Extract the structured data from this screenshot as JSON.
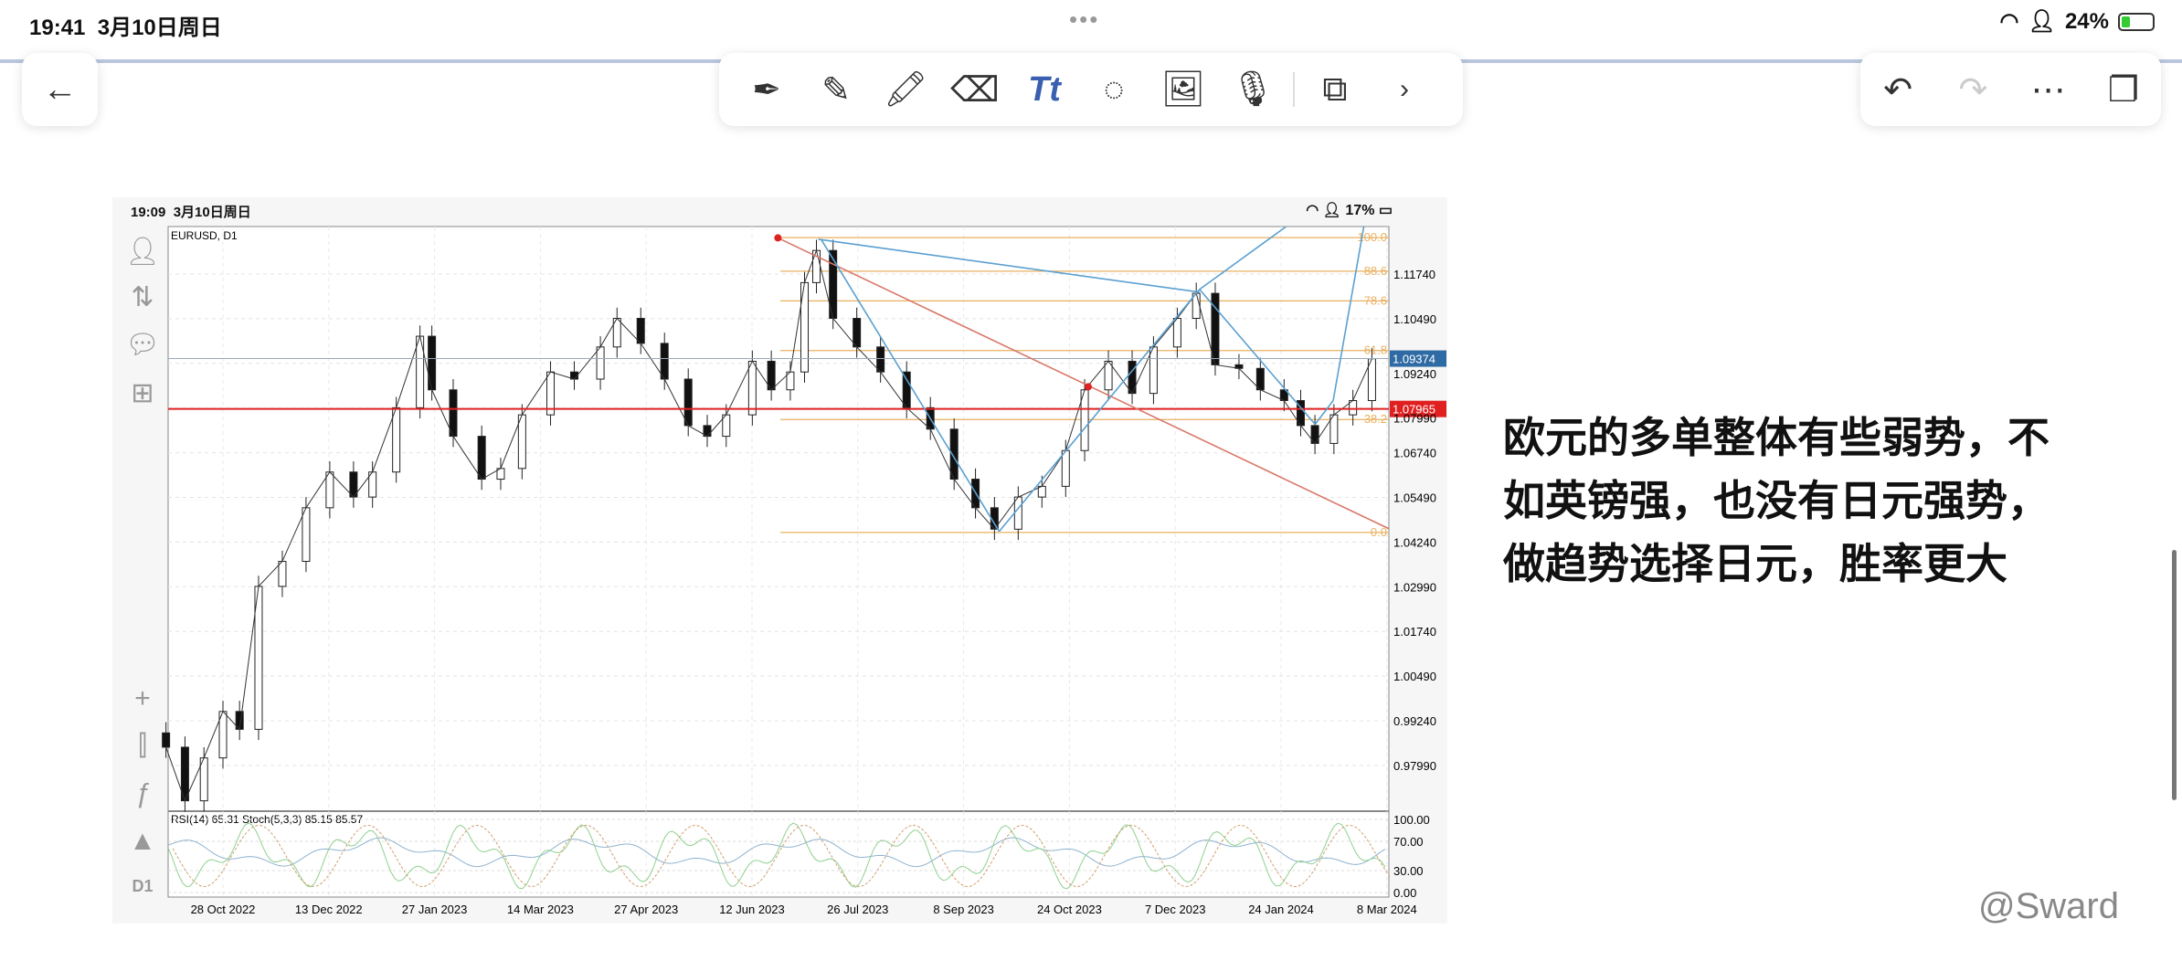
{
  "status_bar": {
    "time": "19:41",
    "date": "3月10日周日",
    "battery": "24%",
    "battery_level": 0.24
  },
  "nav": {
    "back_icon": "arrow-left-icon"
  },
  "toolbar": {
    "tools": [
      "pen-icon",
      "pencil-icon",
      "highlighter-icon",
      "eraser-icon",
      "text-tool-icon",
      "lasso-icon",
      "image-icon",
      "microphone-icon",
      "shape-icon",
      "chevron-right-icon"
    ],
    "text_tool_label": "Tt"
  },
  "right_toolbar": {
    "tools": [
      "undo-icon",
      "redo-icon",
      "more-icon",
      "pages-icon"
    ]
  },
  "screenshot": {
    "status_time": "19:09",
    "status_date": "3月10日周日",
    "battery": "17%",
    "symbol": "EURUSD, D1",
    "timeframe": "D1",
    "indicator_header": "RSI(14) 65.31 Stoch(5,3,3) 85.15 85.57",
    "current_price": "1.09374",
    "current_price_color": "#2e6aa3",
    "red_line_price": "1.07965",
    "red_line_color": "#e02020",
    "price_ticks": [
      "1.11740",
      "1.10490",
      "1.09240",
      "1.07990",
      "1.06740",
      "1.05490",
      "1.04240",
      "1.02990",
      "1.01740",
      "1.00490",
      "0.99240",
      "0.97990"
    ],
    "rsi_ticks": [
      "100.00",
      "70.00",
      "30.00",
      "0.00"
    ],
    "date_ticks": [
      "28 Oct 2022",
      "13 Dec 2022",
      "27 Jan 2023",
      "14 Mar 2023",
      "27 Apr 2023",
      "12 Jun 2023",
      "26 Jul 2023",
      "8 Sep 2023",
      "24 Oct 2023",
      "7 Dec 2023",
      "24 Jan 2024",
      "8 Mar 2024"
    ],
    "fib_levels": [
      {
        "label": "100.0",
        "price": 1.1276
      },
      {
        "label": "88.6",
        "price": 1.1182
      },
      {
        "label": "78.6",
        "price": 1.1099
      },
      {
        "label": "61.8",
        "price": 1.096
      },
      {
        "label": "38.2",
        "price": 1.0767
      },
      {
        "label": "0.0",
        "price": 1.0451
      }
    ],
    "fib_color": "#e8b060",
    "trend_color": "#5aa0d0"
  },
  "chart_data": {
    "type": "line",
    "xlabel": "",
    "ylabel": "",
    "ylim": [
      0.975,
      1.128
    ],
    "series": [
      {
        "values": [
          [
            "2022-10-04",
            0.985
          ],
          [
            "2022-10-12",
            0.97
          ],
          [
            "2022-10-20",
            0.982
          ],
          [
            "2022-10-28",
            0.995
          ],
          [
            "2022-11-04",
            0.99
          ],
          [
            "2022-11-12",
            1.03
          ],
          [
            "2022-11-22",
            1.037
          ],
          [
            "2022-12-02",
            1.052
          ],
          [
            "2022-12-12",
            1.062
          ],
          [
            "2022-12-22",
            1.055
          ],
          [
            "2022-12-30",
            1.062
          ],
          [
            "2023-01-09",
            1.08
          ],
          [
            "2023-01-19",
            1.1
          ],
          [
            "2023-01-24",
            1.085
          ],
          [
            "2023-02-02",
            1.072
          ],
          [
            "2023-02-14",
            1.06
          ],
          [
            "2023-02-22",
            1.063
          ],
          [
            "2023-03-03",
            1.078
          ],
          [
            "2023-03-15",
            1.09
          ],
          [
            "2023-03-25",
            1.088
          ],
          [
            "2023-04-05",
            1.097
          ],
          [
            "2023-04-12",
            1.105
          ],
          [
            "2023-04-22",
            1.098
          ],
          [
            "2023-05-02",
            1.088
          ],
          [
            "2023-05-12",
            1.075
          ],
          [
            "2023-05-20",
            1.072
          ],
          [
            "2023-05-28",
            1.078
          ],
          [
            "2023-06-08",
            1.093
          ],
          [
            "2023-06-16",
            1.085
          ],
          [
            "2023-06-24",
            1.09
          ],
          [
            "2023-06-30",
            1.115
          ],
          [
            "2023-07-05",
            1.124
          ],
          [
            "2023-07-12",
            1.105
          ],
          [
            "2023-07-22",
            1.097
          ],
          [
            "2023-08-01",
            1.09
          ],
          [
            "2023-08-12",
            1.08
          ],
          [
            "2023-08-22",
            1.074
          ],
          [
            "2023-09-01",
            1.06
          ],
          [
            "2023-09-10",
            1.052
          ],
          [
            "2023-09-18",
            1.046
          ],
          [
            "2023-09-28",
            1.055
          ],
          [
            "2023-10-08",
            1.058
          ],
          [
            "2023-10-18",
            1.068
          ],
          [
            "2023-10-26",
            1.085
          ],
          [
            "2023-11-05",
            1.093
          ],
          [
            "2023-11-15",
            1.084
          ],
          [
            "2023-11-24",
            1.097
          ],
          [
            "2023-12-04",
            1.105
          ],
          [
            "2023-12-12",
            1.112
          ],
          [
            "2023-12-20",
            1.092
          ],
          [
            "2023-12-30",
            1.091
          ],
          [
            "2024-01-08",
            1.085
          ],
          [
            "2024-01-18",
            1.082
          ],
          [
            "2024-01-25",
            1.075
          ],
          [
            "2024-01-31",
            1.07
          ],
          [
            "2024-02-08",
            1.078
          ],
          [
            "2024-02-16",
            1.082
          ],
          [
            "2024-02-24",
            1.0937
          ]
        ]
      }
    ]
  },
  "note": {
    "lines": [
      "欧元的多单整体有些弱势，不",
      "如英镑强，也没有日元强势，",
      "做趋势选择日元，胜率更大"
    ]
  },
  "watermark": "@Sward"
}
